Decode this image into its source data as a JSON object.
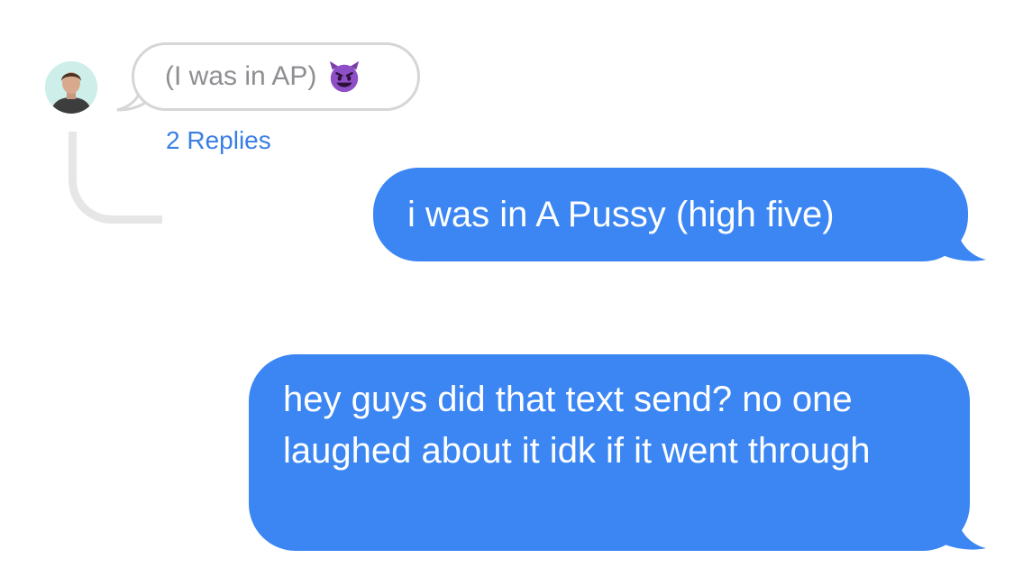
{
  "thread": {
    "quoted_message": {
      "text": "(I was in AP)",
      "emoji_icon": "smiling-devil-emoji-icon"
    },
    "replies_link": "2 Replies"
  },
  "messages": [
    {
      "direction": "outgoing",
      "text": "i was in A Pussy (high five)"
    },
    {
      "direction": "outgoing",
      "text": "hey guys did that text send? no one laughed about it idk if it went through"
    }
  ],
  "colors": {
    "outgoing_bubble": "#3b86f3",
    "link": "#3a7fe4",
    "quoted_text": "#8e8e93",
    "thread_line": "#e6e6e6",
    "avatar_bg": "#cdeee9"
  }
}
